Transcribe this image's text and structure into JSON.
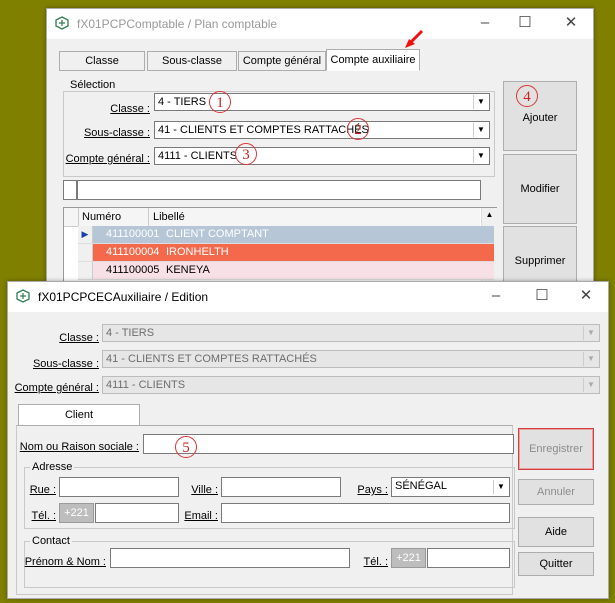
{
  "win1": {
    "title": "fX01PCPComptable / Plan comptable",
    "tabs": [
      "Classe",
      "Sous-classe",
      "Compte général",
      "Compte auxiliaire"
    ],
    "selection_title": "Sélection",
    "labels": {
      "classe": "Classe :",
      "sous_classe": "Sous-classe :",
      "compte_general": "Compte général :"
    },
    "values": {
      "classe": "4 - TIERS",
      "sous_classe": "41 - CLIENTS ET COMPTES RATTACHÉS",
      "compte_general": "4111 - CLIENTS"
    },
    "buttons": {
      "ajouter": "Ajouter",
      "modifier": "Modifier",
      "supprimer": "Supprimer"
    },
    "table": {
      "headers": [
        "Numéro",
        "Libellé"
      ],
      "rows": [
        {
          "numero": "411100001",
          "libelle": "CLIENT COMPTANT",
          "bg": "#b6c6d6"
        },
        {
          "numero": "411100004",
          "libelle": "IRONHELTH",
          "bg": "#f4694c"
        },
        {
          "numero": "411100005",
          "libelle": "KENEYA",
          "bg": "#f8e1e6"
        }
      ]
    }
  },
  "win2": {
    "title": "fX01PCPCECAuxiliaire / Edition",
    "labels": {
      "classe": "Classe :",
      "sous_classe": "Sous-classe :",
      "compte_general": "Compte général :"
    },
    "values": {
      "classe": "4 - TIERS",
      "sous_classe": "41 - CLIENTS ET COMPTES RATTACHÉS",
      "compte_general": "4111 - CLIENTS"
    },
    "tab": "Client",
    "nom_label": "Nom ou Raison sociale :",
    "nom_value": "",
    "adresse_title": "Adresse",
    "rue_label": "Rue :",
    "ville_label": "Ville :",
    "pays_label": "Pays :",
    "pays_value": "SÉNÉGAL",
    "tel_label": "Tél. :",
    "tel_prefix": "+221",
    "email_label": "Email :",
    "contact_title": "Contact",
    "prenom_label": "Prénom & Nom :",
    "contact_tel_label": "Tél. :",
    "contact_tel_prefix": "+221",
    "buttons": {
      "enregistrer": "Enregistrer",
      "annuler": "Annuler",
      "aide": "Aide",
      "quitter": "Quitter"
    }
  },
  "annotations": [
    "1",
    "2",
    "3",
    "4",
    "5"
  ],
  "colors": {
    "background": "#7f7f00",
    "annotation": "#dd3333"
  }
}
